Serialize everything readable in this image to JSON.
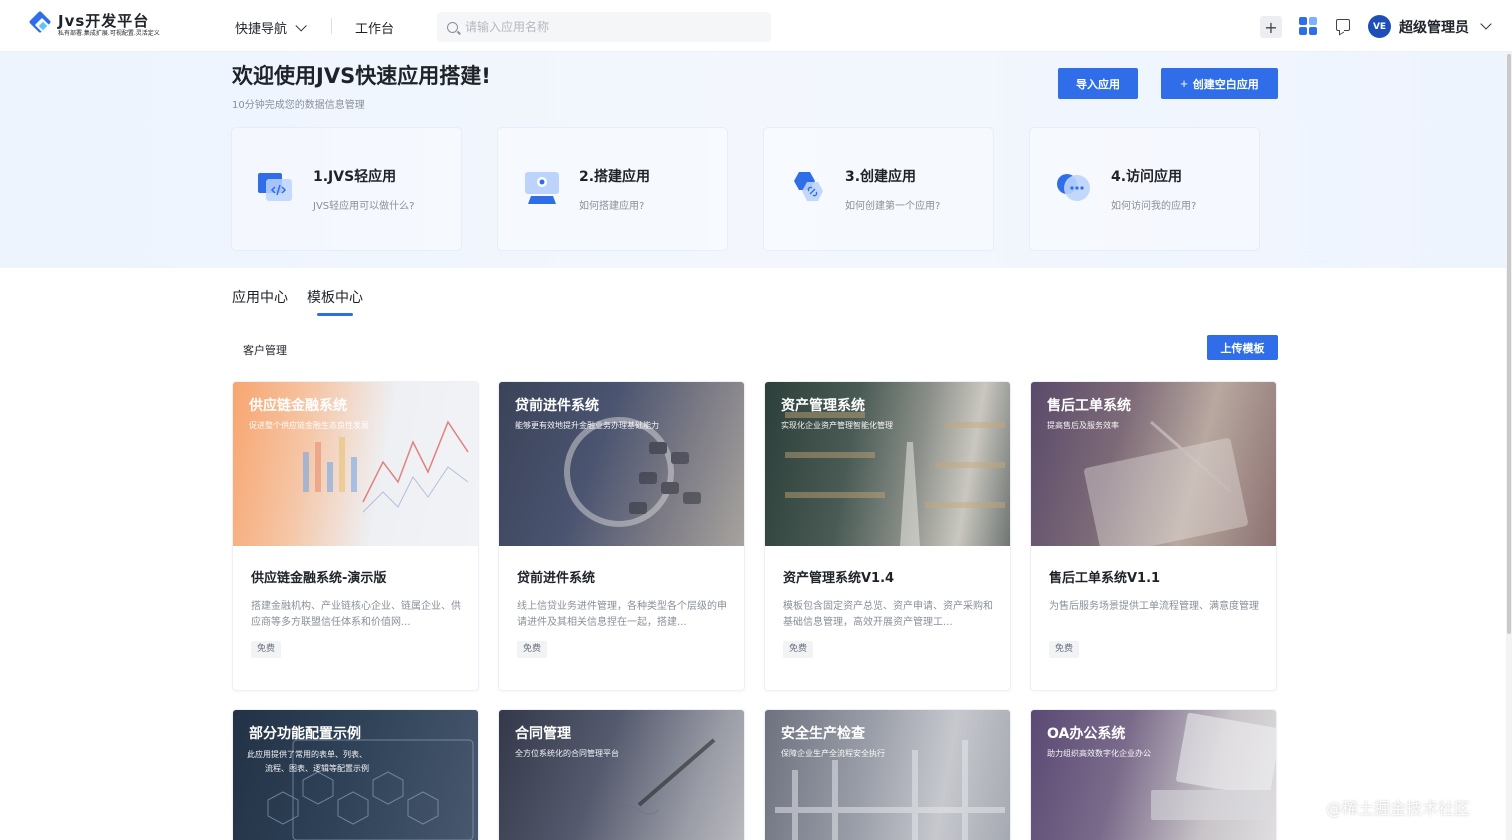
{
  "header": {
    "logo_title": "Jvs开发平台",
    "logo_subtitle": "私有部署.集成扩展.可视配置.灵活定义",
    "quick_nav": "快捷导航",
    "workbench": "工作台",
    "search_placeholder": "请输入应用名称",
    "plus_label": "+",
    "avatar_text": "VE",
    "username": "超级管理员"
  },
  "hero": {
    "title": "欢迎使用JVS快速应用搭建!",
    "subtitle": "10分钟完成您的数据信息管理",
    "import_label": "导入应用",
    "create_label": "创建空白应用",
    "create_icon": "+",
    "steps": [
      {
        "title": "1.JVS轻应用",
        "desc": "JVS轻应用可以做什么?"
      },
      {
        "title": "2.搭建应用",
        "desc": "如何搭建应用?"
      },
      {
        "title": "3.创建应用",
        "desc": "如何创建第一个应用?"
      },
      {
        "title": "4.访问应用",
        "desc": "如何访问我的应用?"
      }
    ]
  },
  "tabs": [
    {
      "label": "应用中心"
    },
    {
      "label": "模板中心"
    }
  ],
  "category": "客户管理",
  "upload_label": "上传模板",
  "cards": [
    {
      "overlay_title": "供应链金融系统",
      "overlay_sub": "促进整个供应链金融生态良性发展",
      "name": "供应链金融系统-演示版",
      "desc": "搭建金融机构、产业链核心企业、链属企业、供应商等多方联盟信任体系和价值网...",
      "tag": "免费"
    },
    {
      "overlay_title": "贷前进件系统",
      "overlay_sub": "能够更有效地提升金融业务办理基础能力",
      "name": "贷前进件系统",
      "desc": "线上信贷业务进件管理，各种类型各个层级的申请进件及其相关信息捏在一起，搭建...",
      "tag": "免费"
    },
    {
      "overlay_title": "资产管理系统",
      "overlay_sub": "实现化企业资产管理智能化管理",
      "name": "资产管理系统V1.4",
      "desc": "模板包含固定资产总览、资产申请、资产采购和基础信息管理，高效开展资产管理工...",
      "tag": "免费"
    },
    {
      "overlay_title": "售后工单系统",
      "overlay_sub": "提高售后及服务效率",
      "name": "售后工单系统V1.1",
      "desc": "为售后服务场景提供工单流程管理、满意度管理",
      "tag": "免费"
    },
    {
      "overlay_title": "部分功能配置示例",
      "overlay_sub": "此应用提供了常用的表单、列表、",
      "overlay_sub2": "流程、图表、逻辑等配置示例"
    },
    {
      "overlay_title": "合同管理",
      "overlay_sub": "全方位系统化的合同管理平台"
    },
    {
      "overlay_title": "安全生产检查",
      "overlay_sub": "保障企业生产全流程安全执行"
    },
    {
      "overlay_title": "OA办公系统",
      "overlay_sub": "助力组织高效数字化企业办公"
    }
  ],
  "watermark": "@稀土掘金技术社区",
  "colors": {
    "accent": "#2f6ee8",
    "hero_bg": "#edf4fe"
  }
}
